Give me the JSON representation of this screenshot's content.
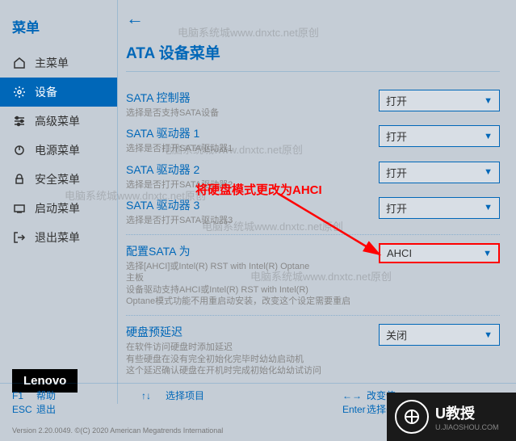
{
  "watermark": "电脑系统城www.dnxtc.net原创",
  "sidebar": {
    "title": "菜单",
    "items": [
      {
        "label": "主菜单",
        "icon": "home"
      },
      {
        "label": "设备",
        "icon": "gear"
      },
      {
        "label": "高级菜单",
        "icon": "sliders"
      },
      {
        "label": "电源菜单",
        "icon": "power"
      },
      {
        "label": "安全菜单",
        "icon": "lock"
      },
      {
        "label": "启动菜单",
        "icon": "boot"
      },
      {
        "label": "退出菜单",
        "icon": "exit"
      }
    ]
  },
  "main": {
    "title": "ATA 设备菜单",
    "settings": [
      {
        "label": "SATA 控制器",
        "desc": "选择是否支持SATA设备",
        "value": "打开"
      },
      {
        "label": "SATA 驱动器 1",
        "desc": "选择是否打开SATA驱动器1",
        "value": "打开"
      },
      {
        "label": "SATA 驱动器 2",
        "desc": "选择是否打开SATA驱动器2",
        "value": "打开"
      },
      {
        "label": "SATA 驱动器 3",
        "desc": "选择是否打开SATA驱动器3",
        "value": "打开"
      }
    ],
    "configure": {
      "label": "配置SATA 为",
      "desc1": "选择[AHCI]或Intel(R) RST with Intel(R) Optane",
      "desc2": "主板",
      "desc3": "设备驱动支持AHCI或Intel(R) RST with Intel(R)",
      "desc4": "Optane模式功能不用重启动安装，改变这个设定需要重启",
      "value": "AHCI"
    },
    "preheat": {
      "label": "硬盘预延迟",
      "desc1": "在软件访问硬盘时添加延迟",
      "desc2": "有些硬盘在没有完全初始化完毕时幼幼启动机",
      "desc3": "这个延迟确认硬盘在开机时完成初始化幼幼试访问",
      "value": "关闭"
    }
  },
  "annotation": "将硬盘模式更改为AHCI",
  "brand": "Lenovo",
  "footer": {
    "f1": "F1",
    "f1_label": "帮助",
    "esc": "ESC",
    "esc_label": "退出",
    "arrows": "↑↓",
    "arrows_label": "选择项目",
    "lr": "←→",
    "lr_label": "改变值",
    "enter": "Enter",
    "enter_label": "选择子菜单"
  },
  "copyright": "Version 2.20.0049. ©(C) 2020 American Megatrends International",
  "ujiaoshou": {
    "brand": "U教授",
    "sub": "U.JIAOSHOU.COM"
  }
}
